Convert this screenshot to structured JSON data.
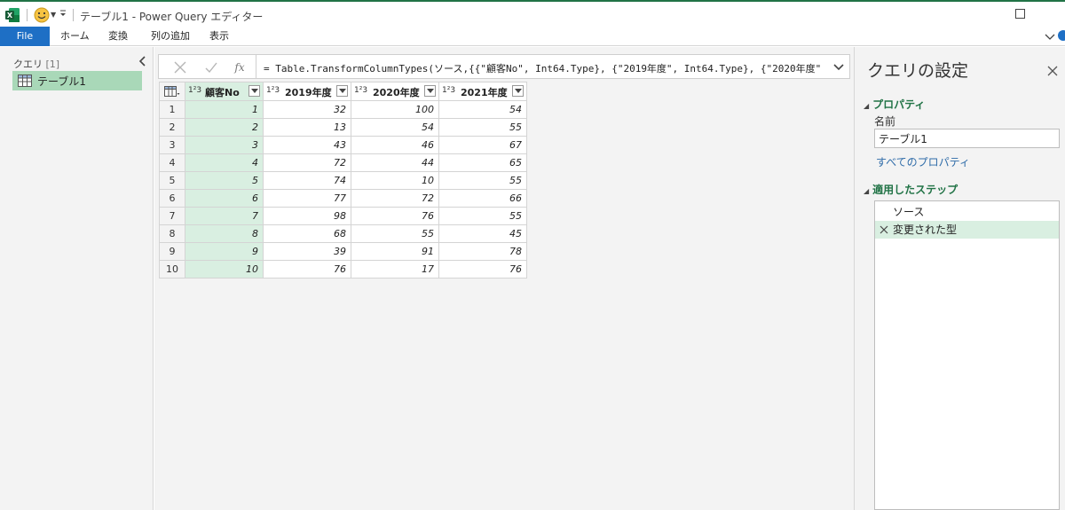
{
  "window": {
    "title": "テーブル1 - Power Query エディター"
  },
  "ribbon": {
    "tabs": [
      {
        "label": "File"
      },
      {
        "label": "ホーム"
      },
      {
        "label": "変換"
      },
      {
        "label": "列の追加"
      },
      {
        "label": "表示"
      }
    ]
  },
  "queries_pane": {
    "title": "クエリ",
    "count": "[1]",
    "items": [
      {
        "label": "テーブル1",
        "selected": true
      }
    ]
  },
  "formula_bar": {
    "formula": "= Table.TransformColumnTypes(ソース,{{\"顧客No\", Int64.Type}, {\"2019年度\", Int64.Type}, {\"2020年度\","
  },
  "grid": {
    "columns": [
      {
        "label": "顧客No",
        "type": "1²3",
        "selected": true
      },
      {
        "label": "2019年度",
        "type": "1²3"
      },
      {
        "label": "2020年度",
        "type": "1²3"
      },
      {
        "label": "2021年度",
        "type": "1²3"
      }
    ],
    "rows": [
      {
        "n": "1",
        "cells": [
          "1",
          "32",
          "100",
          "54"
        ]
      },
      {
        "n": "2",
        "cells": [
          "2",
          "13",
          "54",
          "55"
        ]
      },
      {
        "n": "3",
        "cells": [
          "3",
          "43",
          "46",
          "67"
        ]
      },
      {
        "n": "4",
        "cells": [
          "4",
          "72",
          "44",
          "65"
        ]
      },
      {
        "n": "5",
        "cells": [
          "5",
          "74",
          "10",
          "55"
        ]
      },
      {
        "n": "6",
        "cells": [
          "6",
          "77",
          "72",
          "66"
        ]
      },
      {
        "n": "7",
        "cells": [
          "7",
          "98",
          "76",
          "55"
        ]
      },
      {
        "n": "8",
        "cells": [
          "8",
          "68",
          "55",
          "45"
        ]
      },
      {
        "n": "9",
        "cells": [
          "9",
          "39",
          "91",
          "78"
        ]
      },
      {
        "n": "10",
        "cells": [
          "10",
          "76",
          "17",
          "76"
        ]
      }
    ]
  },
  "settings_pane": {
    "title": "クエリの設定",
    "properties_heading": "プロパティ",
    "name_label": "名前",
    "name_value": "テーブル1",
    "all_properties_link": "すべてのプロパティ",
    "steps_heading": "適用したステップ",
    "steps": [
      {
        "label": "ソース",
        "active": false
      },
      {
        "label": "変更された型",
        "active": true
      }
    ]
  },
  "colors": {
    "accent_green": "#217346",
    "selection_green": "#d9efe1",
    "query_selected": "#a9d8b8",
    "file_tab_blue": "#1e6fc5"
  },
  "icons": [
    "excel-icon",
    "smiley-icon",
    "dropdown-icon",
    "maximize-icon",
    "chevron-down-icon",
    "collapse-chevron-icon",
    "table-icon",
    "cancel-icon",
    "check-icon",
    "fx-icon",
    "expand-chevron-icon",
    "close-icon",
    "delete-step-icon"
  ]
}
